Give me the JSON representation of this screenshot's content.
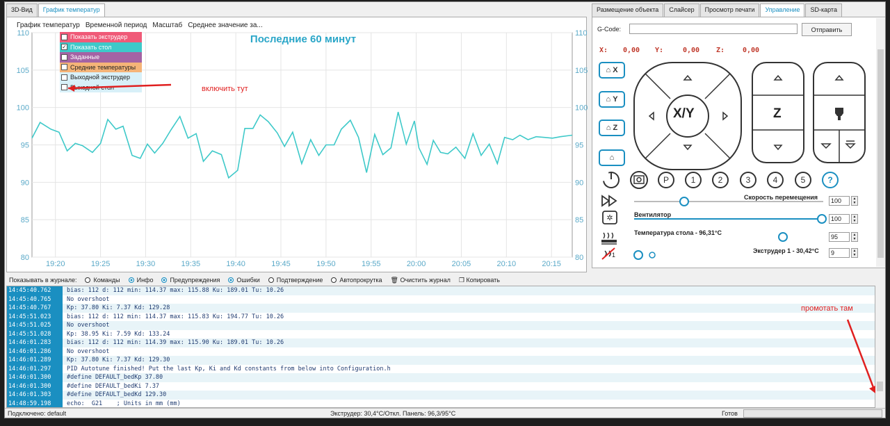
{
  "tabs_left": [
    "3D-Вид",
    "График температур"
  ],
  "chart_menu": [
    "График температур",
    "Временной период",
    "Масштаб",
    "Среднее значение за..."
  ],
  "legend": [
    {
      "label": "Показать экструдер",
      "checked": false,
      "color": "#f05a78"
    },
    {
      "label": "Показать стол",
      "checked": true,
      "color": "#3ec9c9"
    },
    {
      "label": "Заданные",
      "checked": false,
      "color": "#a463a4"
    },
    {
      "label": "Средние температуры",
      "checked": false,
      "color": "#f5b478"
    },
    {
      "label": "Выходной экструдер",
      "checked": false,
      "color": "#d8f0f8"
    },
    {
      "label": "Выходной стол",
      "checked": false,
      "color": "#d8f0f8"
    }
  ],
  "chart_data": {
    "type": "line",
    "title": "Последние 60 минут",
    "xlabel": "",
    "ylabel": "",
    "ylim": [
      80,
      110
    ],
    "yticks": [
      80,
      85,
      90,
      95,
      100,
      105,
      110
    ],
    "x_tick_labels": [
      "19:20",
      "19:25",
      "19:30",
      "19:35",
      "19:40",
      "19:45",
      "19:50",
      "19:55",
      "20:00",
      "20:05",
      "20:10",
      "20:15"
    ],
    "x_tick_minutes": [
      5,
      10,
      15,
      20,
      25,
      30,
      35,
      40,
      45,
      50,
      55,
      60
    ],
    "xlim_minutes": [
      2.4,
      62.3
    ],
    "grid": true,
    "series": [
      {
        "color": "#3ec9c9",
        "x": [
          2.4,
          3.3,
          4.5,
          5.4,
          6.3,
          7.2,
          8.0,
          9.1,
          10.0,
          10.8,
          11.7,
          12.5,
          13.5,
          14.4,
          15.2,
          16.0,
          16.9,
          17.8,
          18.8,
          19.7,
          20.6,
          21.4,
          22.4,
          23.4,
          24.2,
          25.2,
          26.0,
          26.9,
          27.7,
          28.6,
          29.6,
          30.4,
          31.3,
          32.3,
          33.3,
          34.2,
          35.0,
          35.9,
          36.7,
          37.7,
          38.6,
          39.5,
          40.4,
          41.3,
          42.2,
          43.0,
          43.9,
          44.8,
          45.3,
          46.2,
          46.9,
          47.7,
          48.5,
          49.4,
          50.4,
          51.3,
          52.2,
          53.1,
          54.0,
          54.8,
          55.7,
          56.5,
          57.4,
          58.3,
          59.2,
          60.1,
          61.0,
          62.3
        ],
        "y": [
          95.9,
          98.0,
          97.1,
          96.7,
          94.2,
          95.2,
          94.9,
          94.0,
          95.2,
          98.4,
          97.1,
          97.5,
          93.6,
          93.2,
          95.1,
          93.9,
          95.2,
          97.0,
          98.8,
          95.9,
          96.5,
          92.8,
          94.2,
          93.7,
          90.6,
          91.6,
          97.2,
          97.2,
          99.0,
          98.1,
          96.6,
          94.8,
          96.7,
          92.5,
          95.7,
          93.6,
          95.0,
          95.0,
          97.1,
          98.3,
          96.0,
          91.3,
          96.4,
          93.7,
          94.6,
          99.4,
          95.1,
          98.2,
          94.6,
          92.4,
          95.6,
          94.0,
          93.8,
          94.7,
          93.2,
          96.5,
          93.6,
          95.1,
          92.5,
          96.0,
          95.7,
          96.3,
          95.7,
          96.1,
          96.0,
          95.9,
          96.1,
          96.3
        ]
      }
    ]
  },
  "tabs_right": [
    "Размещение объекта",
    "Слайсер",
    "Просмотр печати",
    "Управление",
    "SD-карта"
  ],
  "gcode": {
    "label": "G-Code:",
    "value": "",
    "send": "Отправить"
  },
  "coords": {
    "x_label": "X:",
    "x": "0,00",
    "y_label": "Y:",
    "y": "0,00",
    "z_label": "Z:",
    "z": "0,00"
  },
  "home_buttons": [
    "X",
    "Y",
    "Z",
    ""
  ],
  "jog": {
    "xy": "X/Y",
    "z": "Z"
  },
  "num_buttons": [
    "P",
    "1",
    "2",
    "3",
    "4",
    "5",
    "?"
  ],
  "sliders": [
    {
      "label": "Скорость перемещения",
      "value": "100"
    },
    {
      "label": "Вентилятор",
      "value": "100"
    },
    {
      "label": "Температура стола - 96,31°C",
      "value": "95"
    },
    {
      "label": "Экструдер 1 - 30,42°C",
      "value": "9"
    }
  ],
  "extruder_badge": "1",
  "log_toolbar": {
    "prefix": "Показывать в журнале:",
    "options": [
      {
        "label": "Команды",
        "on": false
      },
      {
        "label": "Инфо",
        "on": true
      },
      {
        "label": "Предупреждения",
        "on": true
      },
      {
        "label": "Ошибки",
        "on": true
      },
      {
        "label": "Подтверждение",
        "on": false
      },
      {
        "label": "Автопрокрутка",
        "on": false
      }
    ],
    "clear": "Очистить журнал",
    "copy": "Копировать"
  },
  "log": [
    {
      "ts": "14:45:40.762",
      "msg": "bias: 112 d: 112 min: 114.37 max: 115.88 Ku: 189.01 Tu: 10.26"
    },
    {
      "ts": "14:45:40.765",
      "msg": "No overshoot"
    },
    {
      "ts": "14:45:40.767",
      "msg": "Kp: 37.80 Ki: 7.37 Kd: 129.28"
    },
    {
      "ts": "14:45:51.023",
      "msg": "bias: 112 d: 112 min: 114.37 max: 115.83 Ku: 194.77 Tu: 10.26"
    },
    {
      "ts": "14:45:51.025",
      "msg": "No overshoot"
    },
    {
      "ts": "14:45:51.028",
      "msg": "Kp: 38.95 Ki: 7.59 Kd: 133.24"
    },
    {
      "ts": "14:46:01.283",
      "msg": "bias: 112 d: 112 min: 114.39 max: 115.90 Ku: 189.01 Tu: 10.26"
    },
    {
      "ts": "14:46:01.286",
      "msg": "No overshoot"
    },
    {
      "ts": "14:46:01.289",
      "msg": "Kp: 37.80 Ki: 7.37 Kd: 129.30"
    },
    {
      "ts": "14:46:01.297",
      "msg": "PID Autotune finished! Put the last Kp, Ki and Kd constants from below into Configuration.h"
    },
    {
      "ts": "14:46:01.300",
      "msg": "#define DEFAULT_bedKp 37.80"
    },
    {
      "ts": "14:46:01.300",
      "msg": "#define DEFAULT_bedKi 7.37"
    },
    {
      "ts": "14:46:01.303",
      "msg": "#define DEFAULT_bedKd 129.30"
    },
    {
      "ts": "14:48:59.198",
      "msg": "echo:  G21    ; Units in mm (mm)"
    }
  ],
  "status": {
    "connected": "Подключено: default",
    "temps": "Экструдер: 30,4°C/Откл. Панель: 96,3/95°C",
    "ready": "Готов"
  },
  "annotations": {
    "enable_here": "включить тут",
    "scroll_there": "промотать там"
  },
  "colors": {
    "accent": "#1a8fc1",
    "line": "#3ec9c9",
    "annotation": "#e02020"
  }
}
